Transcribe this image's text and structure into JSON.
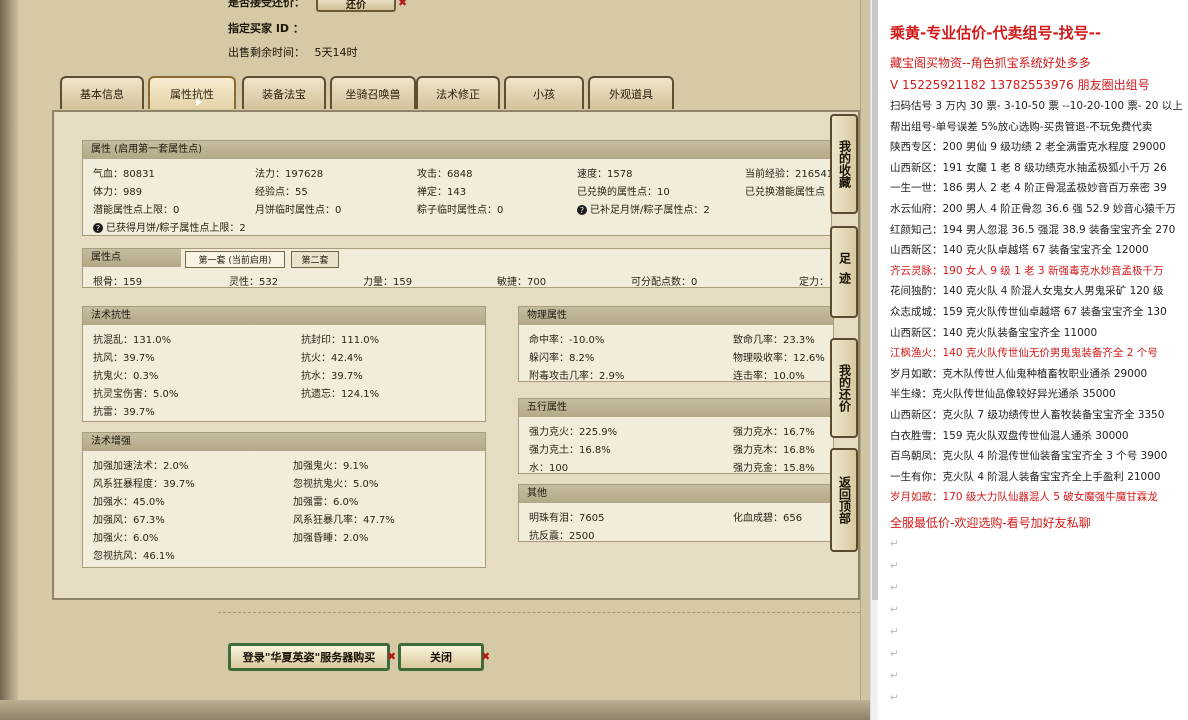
{
  "top": {
    "accept_bargain_label": "是否接受还价：",
    "bargain_button": "还价",
    "buyer_id_label": "指定买家 ID ：",
    "time_label": "出售剩余时间：",
    "time_value": "5天14时"
  },
  "tabs": [
    "基本信息",
    "属性抗性",
    "装备法宝",
    "坐骑召唤兽",
    "法术修正",
    "小孩",
    "外观道具"
  ],
  "side_buttons": [
    "我的收藏",
    "足迹",
    "我的还价",
    "返回顶部"
  ],
  "attr_panel": {
    "title": "属性 (启用第一套属性点)",
    "row1": [
      "气血：80831",
      "法力：197628",
      "攻击：6848",
      "速度：1578",
      "当前经验：216541"
    ],
    "row2": [
      "体力：989",
      "经验点：55",
      "禅定：143",
      "已兑换的属性点：10",
      "已兑换潜能属性点"
    ],
    "row3": [
      "潜能属性点上限：0",
      "月饼临时属性点：0",
      "粽子临时属性点：0",
      "已补足月饼/粽子属性点：2"
    ],
    "row4": "已获得月饼/粽子属性点上限：2"
  },
  "points_panel": {
    "title": "属性点",
    "subtab1": "第一套 (当前启用)",
    "subtab2": "第二套",
    "values": [
      "根骨：159",
      "灵性：532",
      "力量：159",
      "敏捷：700",
      "可分配点数：0",
      "定力："
    ]
  },
  "magic_resist": {
    "title": "法术抗性",
    "items": [
      "抗混乱：131.0%",
      "抗封印：111.0%",
      "抗风：39.7%",
      "抗火：42.4%",
      "抗鬼火：0.3%",
      "抗水：39.7%",
      "抗灵宝伤害：5.0%",
      "抗遗忘：124.1%",
      "抗雷：39.7%"
    ]
  },
  "magic_boost": {
    "title": "法术增强",
    "items": [
      "加强加速法术：2.0%",
      "加强鬼火：9.1%",
      "风系狂暴程度：39.7%",
      "忽视抗鬼火：5.0%",
      "加强水：45.0%",
      "加强雷：6.0%",
      "加强风：67.3%",
      "风系狂暴几率：47.7%",
      "加强火：6.0%",
      "加强昏睡：2.0%",
      "忽视抗风：46.1%"
    ]
  },
  "physical": {
    "title": "物理属性",
    "items": [
      "命中率：-10.0%",
      "致命几率：23.3%",
      "躲闪率：8.2%",
      "物理吸收率：12.6%",
      "附毒攻击几率：2.9%",
      "连击率：10.0%"
    ]
  },
  "elements": {
    "title": "五行属性",
    "items": [
      "强力克火：225.9%",
      "强力克水：16.7%",
      "强力克土：16.8%",
      "强力克木：16.8%",
      "水：100",
      "强力克金：15.8%"
    ]
  },
  "other": {
    "title": "其他",
    "items": [
      "明珠有泪：7605",
      "化血成碧：656",
      "抗反震：2500"
    ]
  },
  "bottom": {
    "login_button": "登录\"华夏英姿\"服务器购买",
    "close_button": "关闭"
  },
  "doc": {
    "heading": "乘黄-专业估价-代卖组号-找号--",
    "line2": "藏宝阁买物资--角色抓宝系统好处多多",
    "line3": "V 15225921182   13782553976 朋友圈出组号",
    "lines": [
      {
        "t": "扫码估号 3 万内 30 票- 3-10-50 票 --10-20-100 票- 20 以上",
        "r": false
      },
      {
        "t": "帮出组号-单号误差 5%放心选购-买贵管退-不玩免费代卖",
        "r": false
      },
      {
        "t": "陕西专区：200 男仙 9 级功绩 2 老全满雷克水程度 29000",
        "r": false
      },
      {
        "t": "山西新区：191 女魔 1 老 8 级功绩克水抽孟极狐小千万 26",
        "r": false
      },
      {
        "t": "一生一世：186 男人 2 老 4 阶正骨混孟极妙音百万亲密 39",
        "r": false
      },
      {
        "t": "水云仙府：200 男人 4 阶正骨忽 36.6 强 52.9 妙音心猿千万",
        "r": false
      },
      {
        "t": "红颜知己：194 男人忽混 36.5 强混 38.9 装备宝宝齐全 270",
        "r": false
      },
      {
        "t": "山西新区：140 克火队卓越塔 67 装备宝宝齐全 12000",
        "r": false
      },
      {
        "t": "齐云灵脉：190 女人 9 级 1 老 3 新强毒克水妙音孟极千万",
        "r": true
      },
      {
        "t": "花间独酌：140 克火队 4 阶混人女鬼女人男鬼采矿 120 级",
        "r": false
      },
      {
        "t": "众志成城：159 克火队传世仙卓越塔 67 装备宝宝齐全 130",
        "r": false
      },
      {
        "t": "山西新区：140 克火队装备宝宝齐全 11000",
        "r": false
      },
      {
        "t": "江枫渔火：140 克火队传世仙无价男鬼鬼装备齐全 2 个号",
        "r": true
      },
      {
        "t": "岁月如歌：克木队传世人仙鬼种植畜牧职业通杀 29000",
        "r": false
      },
      {
        "t": "半生缘：克火队传世仙品像较好异光通杀 35000",
        "r": false
      },
      {
        "t": "山西新区：克火队 7 级功绩传世人畜牧装备宝宝齐全 3350",
        "r": false
      },
      {
        "t": "白衣胜雪：159 克火队双盘传世仙混人通杀 30000",
        "r": false
      },
      {
        "t": "百鸟朝凤：克火队 4 阶混传世仙装备宝宝齐全 3 个号 3900",
        "r": false
      },
      {
        "t": "一生有你：克火队 4 阶混人装备宝宝齐全上手盈利 21000",
        "r": false
      },
      {
        "t": "岁月如歌：170 级大力队仙器混人 5 破女魔强牛魔甘霖龙",
        "r": true
      }
    ],
    "footer": "全服最低价-欢迎选购-看号加好友私聊"
  }
}
